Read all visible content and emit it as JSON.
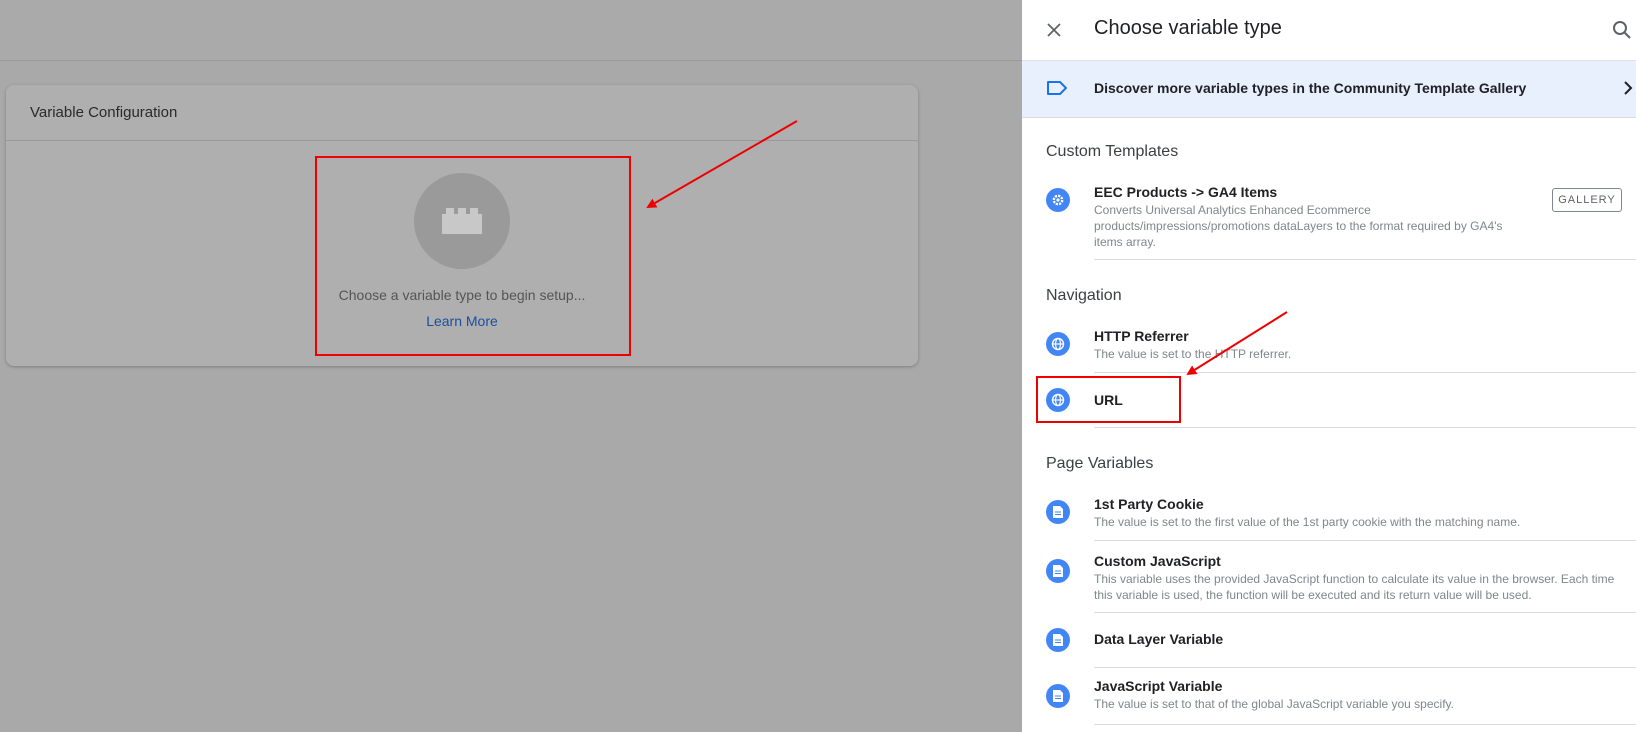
{
  "config_card": {
    "title": "Variable Configuration",
    "placeholder_text": "Choose a variable type to begin setup...",
    "learn_more": "Learn More"
  },
  "panel": {
    "title": "Choose variable type",
    "discover_banner": "Discover more variable types in the Community Template Gallery",
    "gallery_button": "GALLERY",
    "sections": [
      {
        "title": "Custom Templates",
        "items": [
          {
            "title": "EEC Products -> GA4 Items",
            "description": "Converts Universal Analytics Enhanced Ecommerce products/impressions/promotions dataLayers to the format required by GA4's items array.",
            "icon": "gear-icon"
          }
        ]
      },
      {
        "title": "Navigation",
        "items": [
          {
            "title": "HTTP Referrer",
            "description": "The value is set to the HTTP referrer.",
            "icon": "globe-icon"
          },
          {
            "title": "URL",
            "description": "",
            "icon": "globe-icon"
          }
        ]
      },
      {
        "title": "Page Variables",
        "items": [
          {
            "title": "1st Party Cookie",
            "description": "The value is set to the first value of the 1st party cookie with the matching name.",
            "icon": "document-icon"
          },
          {
            "title": "Custom JavaScript",
            "description": "This variable uses the provided JavaScript function to calculate its value in the browser. Each time this variable is used, the function will be executed and its return value will be used.",
            "icon": "document-icon"
          },
          {
            "title": "Data Layer Variable",
            "description": "",
            "icon": "document-icon"
          },
          {
            "title": "JavaScript Variable",
            "description": "The value is set to that of the global JavaScript variable you specify.",
            "icon": "document-icon"
          }
        ]
      }
    ]
  },
  "colors": {
    "accent_blue": "#4285f4",
    "banner_bg": "#e8f0fe",
    "highlight_red": "#ee0000",
    "link_blue": "#1a4fa0"
  }
}
